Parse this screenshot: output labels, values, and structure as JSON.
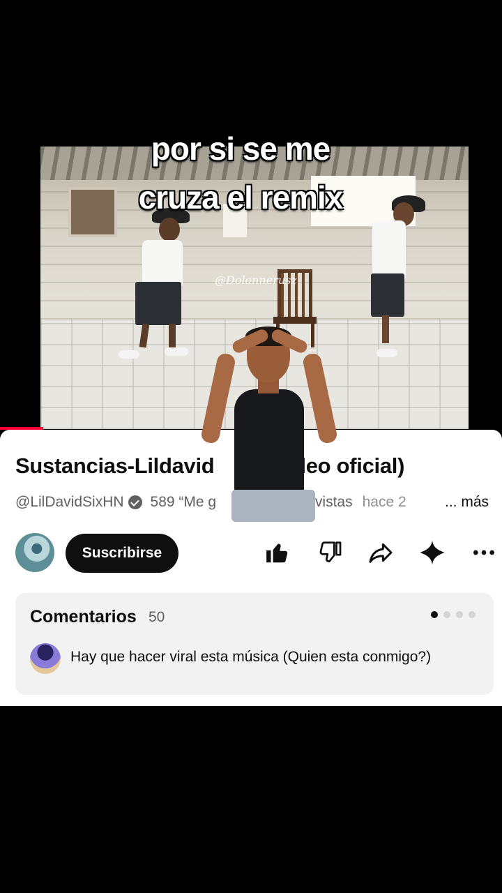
{
  "overlay_caption": {
    "line1": "por si se me",
    "line2": "cruza el remix"
  },
  "video": {
    "watermark": "@Dolannerusz",
    "progress_percent": 9
  },
  "video_info": {
    "title": "Sustancias-Lildavid (Video oficial)",
    "title_visible_left": "Sustancias-Lildavid",
    "title_visible_right": "deo oficial)",
    "channel": "@LilDavidSixHN",
    "likes_fragment": "589 “Me g",
    "views_fragment": "K vistas",
    "time_fragment": "hace 2",
    "more_label": "... más"
  },
  "actions": {
    "subscribe_label": "Suscribirse",
    "icons": [
      "thumbs-up-icon",
      "thumbs-down-icon",
      "share-icon",
      "sparkle-icon",
      "more-icon"
    ]
  },
  "comments": {
    "title": "Comentarios",
    "count": "50",
    "first_comment": "Hay que hacer viral esta música (Quien esta conmigo?)",
    "page_dots": 4,
    "active_dot": 0
  },
  "colors": {
    "progress_red": "#ff0033",
    "text_primary": "#0f0f0f",
    "text_secondary": "#606060",
    "comment_bg": "#f2f2f2"
  }
}
